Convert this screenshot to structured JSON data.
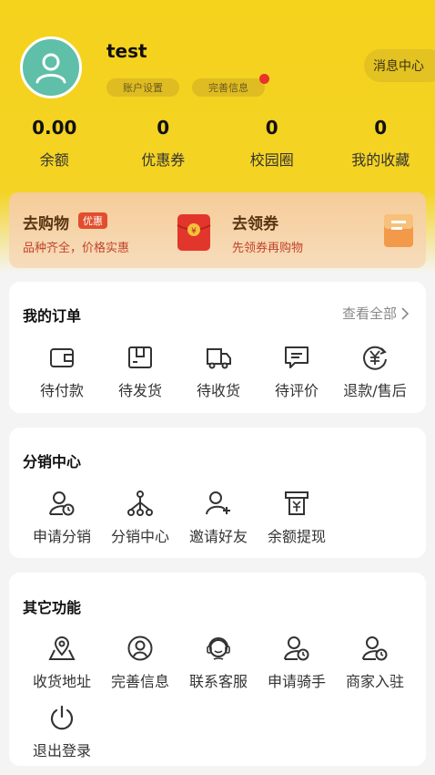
{
  "profile": {
    "username": "test",
    "account_settings": "账户设置",
    "complete_info": "完善信息",
    "message_center": "消息中心"
  },
  "stats": [
    {
      "value": "0.00",
      "label": "余额"
    },
    {
      "value": "0",
      "label": "优惠券"
    },
    {
      "value": "0",
      "label": "校园圈"
    },
    {
      "value": "0",
      "label": "我的收藏"
    }
  ],
  "promo": {
    "shop_title": "去购物",
    "shop_badge": "优惠",
    "shop_sub": "品种齐全，价格实惠",
    "coupon_title": "去领券",
    "coupon_sub": "先领券再购物",
    "redpacket_symbol": "¥"
  },
  "orders": {
    "title": "我的订单",
    "view_all": "查看全部",
    "items": [
      {
        "label": "待付款",
        "icon": "wallet-icon"
      },
      {
        "label": "待发货",
        "icon": "box-icon"
      },
      {
        "label": "待收货",
        "icon": "truck-icon"
      },
      {
        "label": "待评价",
        "icon": "comment-icon"
      },
      {
        "label": "退款/售后",
        "icon": "refund-icon"
      }
    ]
  },
  "distribution": {
    "title": "分销中心",
    "items": [
      {
        "label": "申请分销",
        "icon": "user-clock-icon"
      },
      {
        "label": "分销中心",
        "icon": "network-icon"
      },
      {
        "label": "邀请好友",
        "icon": "user-add-icon"
      },
      {
        "label": "余额提现",
        "icon": "atm-icon"
      }
    ]
  },
  "other": {
    "title": "其它功能",
    "items": [
      {
        "label": "收货地址",
        "icon": "location-icon"
      },
      {
        "label": "完善信息",
        "icon": "user-circle-icon"
      },
      {
        "label": "联系客服",
        "icon": "customer-service-icon"
      },
      {
        "label": "申请骑手",
        "icon": "user-clock-icon"
      },
      {
        "label": "商家入驻",
        "icon": "user-clock-icon"
      },
      {
        "label": "退出登录",
        "icon": "power-icon"
      }
    ]
  },
  "colors": {
    "header": "#f5d21c",
    "promo_bg": "#f5cc97",
    "badge": "#e24d2d",
    "red_dot": "#e8322b",
    "avatar": "#5fbfa8"
  }
}
